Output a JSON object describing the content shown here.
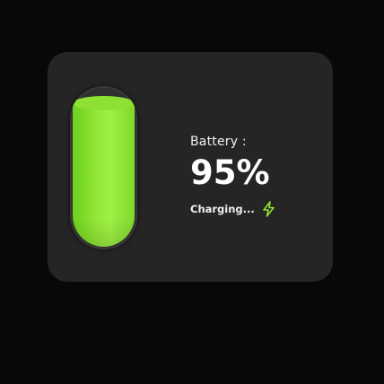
{
  "battery": {
    "label": "Battery :",
    "level_percent": 95,
    "percent_text": "95%",
    "status": "Charging...",
    "status_icon": "lightning-bolt-icon",
    "fill_color": "#8fe534",
    "bolt_color": "#8fe534"
  }
}
